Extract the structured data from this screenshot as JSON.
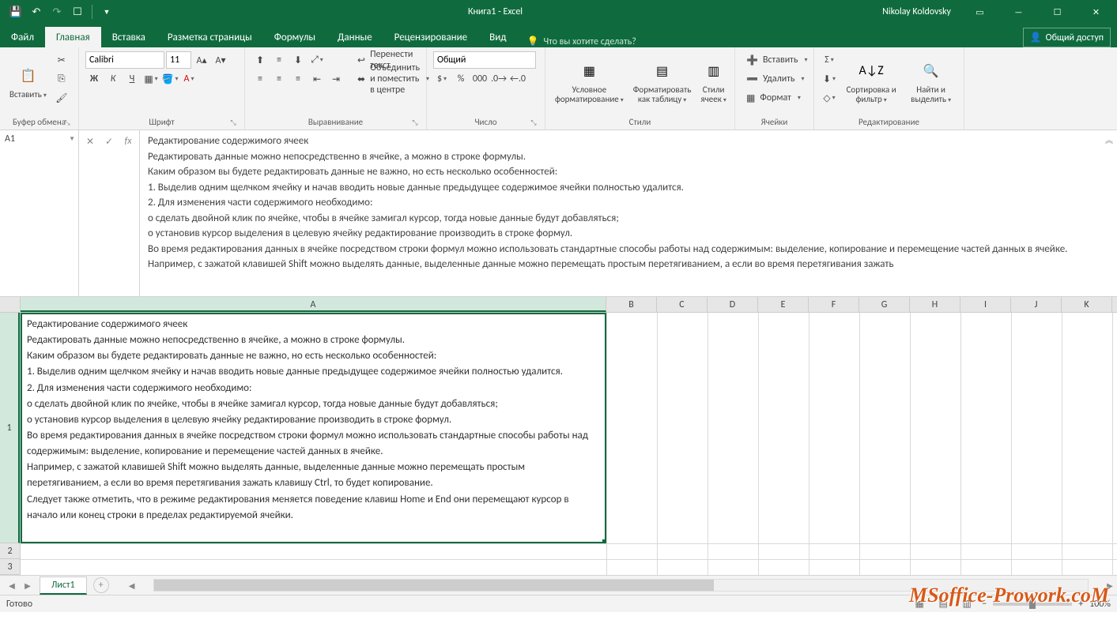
{
  "title": "Книга1 - Excel",
  "user": "Nikolay Koldovsky",
  "tabs": {
    "file": "Файл",
    "home": "Главная",
    "insert": "Вставка",
    "page_layout": "Разметка страницы",
    "formulas": "Формулы",
    "data": "Данные",
    "review": "Рецензирование",
    "view": "Вид"
  },
  "tell_me": "Что вы хотите сделать?",
  "share": "Общий доступ",
  "ribbon": {
    "clipboard": {
      "label": "Буфер обмена",
      "paste": "Вставить"
    },
    "font": {
      "label": "Шрифт",
      "name": "Calibri",
      "size": "11",
      "bold": "Ж",
      "italic": "К",
      "underline": "Ч"
    },
    "alignment": {
      "label": "Выравнивание",
      "wrap": "Перенести текст",
      "merge": "Объединить и поместить в центре"
    },
    "number": {
      "label": "Число",
      "format": "Общий"
    },
    "styles": {
      "label": "Стили",
      "conditional": "Условное форматирование",
      "table": "Форматировать как таблицу",
      "cell_styles": "Стили ячеек"
    },
    "cells": {
      "label": "Ячейки",
      "insert": "Вставить",
      "delete": "Удалить",
      "format": "Формат"
    },
    "editing": {
      "label": "Редактирование",
      "sort": "Сортировка и фильтр",
      "find": "Найти и выделить"
    }
  },
  "namebox": "A1",
  "formula_lines": [
    "Редактирование содержимого ячеек",
    "Редактировать данные можно непосредственно в ячейке, а можно в строке формулы.",
    "Каким образом вы будете редактировать данные не важно, но есть несколько особенностей:",
    "1. Выделив одним щелчком ячейку и начав вводить новые данные предыдущее содержимое ячейки полностью удалится.",
    "2. Для изменения части содержимого необходимо:",
    "o сделать двойной клик по ячейке, чтобы в ячейке замигал курсор, тогда новые данные будут добавляться;",
    "o установив курсор выделения в целевую ячейку редактирование производить в строке формул.",
    "Во время редактирования данных в ячейке посредством строки формул можно использовать стандартные способы работы над содержимым: выделение, копирование и перемещение частей данных в ячейке.",
    "Например, с зажатой клавишей Shift можно выделять данные, выделенные данные можно перемещать простым перетягиванием, а если во время перетягивания зажать"
  ],
  "cell_lines": [
    "Редактирование содержимого ячеек",
    "Редактировать данные можно непосредственно в ячейке, а можно в строке формулы.",
    "Каким образом вы будете редактировать данные не важно, но есть несколько особенностей:",
    "1. Выделив одним щелчком ячейку и начав вводить новые данные предыдущее содержимое ячейки полностью удалится.",
    "2. Для изменения части содержимого необходимо:",
    "o сделать двойной клик по ячейке, чтобы в ячейке замигал курсор, тогда новые данные будут добавляться;",
    "o установив курсор выделения в целевую ячейку редактирование производить в строке формул.",
    "Во время редактирования данных в ячейке посредством строки формул можно использовать стандартные способы работы над содержимым: выделение, копирование и перемещение частей данных в ячейке.",
    "Например, с зажатой клавишей Shift можно выделять данные, выделенные данные можно перемещать простым перетягиванием, а если во время перетягивания зажать клавишу Ctrl, то будет копирование.",
    "Следует также отметить, что в режиме редактирования меняется поведение клавиш Home и End они перемещают курсор в начало или конец строки в пределах редактируемой ячейки."
  ],
  "columns": [
    "A",
    "B",
    "C",
    "D",
    "E",
    "F",
    "G",
    "H",
    "I",
    "J",
    "K"
  ],
  "rows": [
    "1",
    "2",
    "3"
  ],
  "sheet_tab": "Лист1",
  "status": "Готово",
  "zoom": "100%",
  "watermark": "MSoffice-Prowork.coM"
}
